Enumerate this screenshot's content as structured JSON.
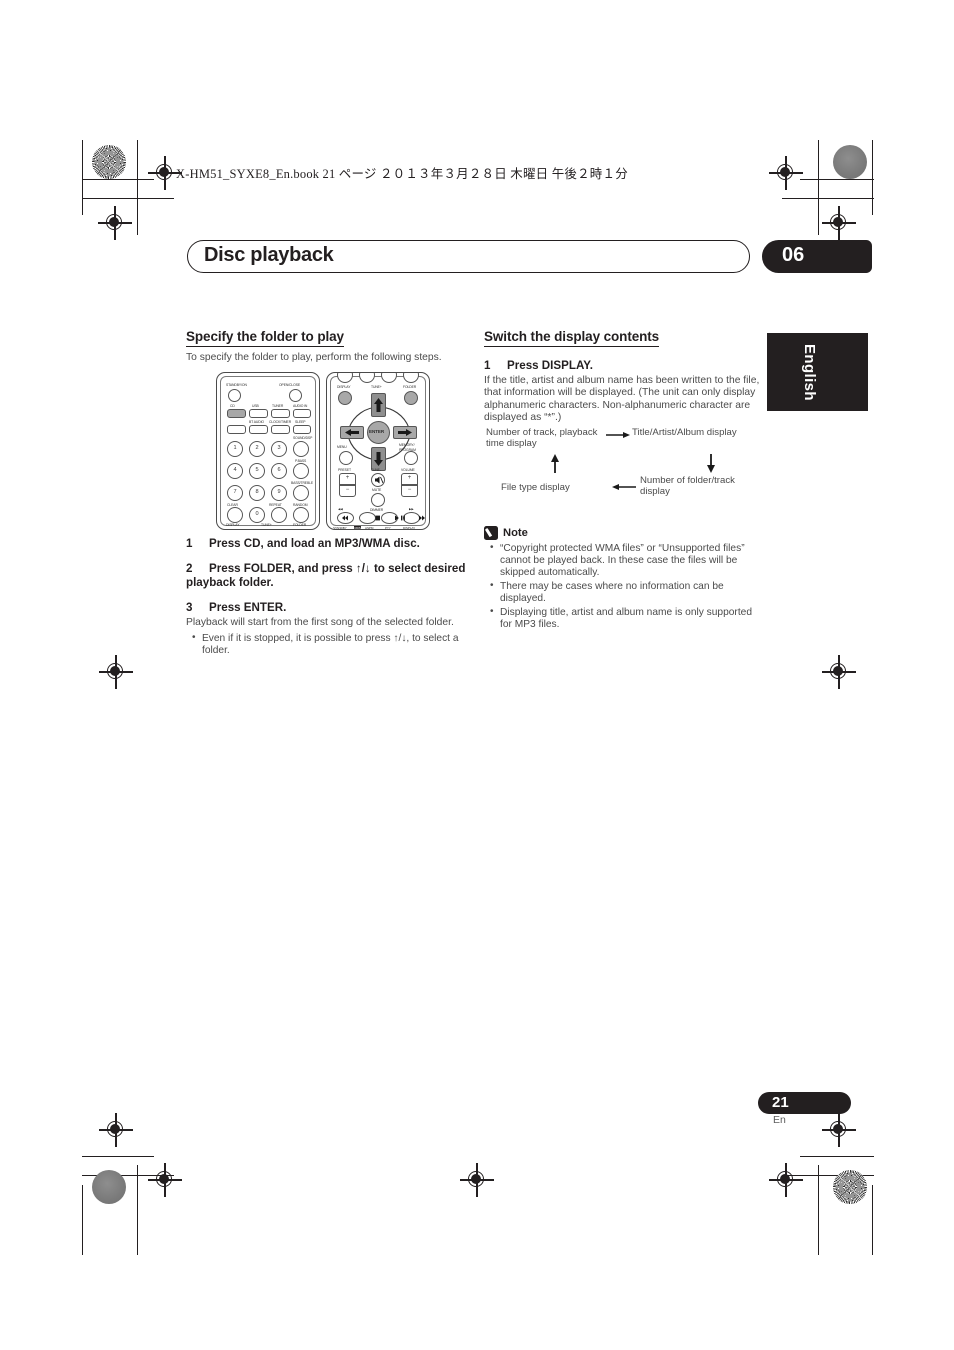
{
  "print_header": {
    "filepath_line": "X-HM51_SYXE8_En.book  21 ページ  ２０１３年３月２８日  木曜日  午後２時１分"
  },
  "chapter": {
    "title": "Disc playback",
    "number": "06"
  },
  "side_tab": {
    "language": "English"
  },
  "footer": {
    "page_number": "21",
    "page_language": "En"
  },
  "left_column": {
    "heading": "Specify the folder to play",
    "intro": "To specify the folder to play, perform the following steps.",
    "steps": [
      {
        "number": "1",
        "text": "Press CD, and load an MP3/WMA disc.",
        "sub": ""
      },
      {
        "number": "2",
        "text": "Press FOLDER, and press ↑/↓ to select desired playback folder.",
        "sub": ""
      },
      {
        "number": "3",
        "text": "Press ENTER.",
        "sub": "Playback will start from the first song of the selected folder."
      }
    ],
    "bullets": [
      "Even if it is stopped, it is possible to press ↑/↓, to select a folder."
    ]
  },
  "right_column": {
    "heading": "Switch the display contents",
    "step": {
      "number": "1",
      "text": "Press DISPLAY.",
      "sub": "If the title, artist and album name has been written to the file, that information will be displayed. (The unit can only display alphanumeric characters. Non-alphanumeric character are displayed as “*”.)"
    },
    "cycle_diagram": {
      "top_left": "Number of track, playback time display",
      "top_right": "Title/Artist/Album display",
      "bottom_left": "File type display",
      "bottom_right": "Number of folder/track display",
      "arrow_right": "→",
      "arrow_left": "←",
      "arrow_up": "↑",
      "arrow_down": "↓"
    },
    "note": {
      "label": "Note",
      "items": [
        "“Copyright protected WMA files” or “Unsupported files” cannot be played back. In these case the files will be skipped automatically.",
        "There may be cases where no information can be displayed.",
        "Displaying title, artist and album name is only supported for MP3 files."
      ]
    }
  },
  "remote_a": {
    "labels": {
      "standby": "STANDBY/ON",
      "open_close": "OPEN/CLOSE",
      "cd": "CD",
      "usb": "USB",
      "tuner": "TUNER",
      "audio_in": "AUDIO IN",
      "bt_audio": "BT AUDIO",
      "clock_timer": "CLOCK/TIMER",
      "sleep": "SLEEP",
      "sound": "SOUND/DSP",
      "pbass": "P.BASS",
      "bass_treble": "BASS/TREBLE",
      "clear": "CLEAR",
      "repeat": "REPEAT",
      "random": "RANDOM",
      "display": "DISPLAY",
      "tune_plus": "TUNE+",
      "folder": "FOLDER"
    },
    "keypad": [
      "1",
      "2",
      "3",
      "4",
      "5",
      "6",
      "7",
      "8",
      "9",
      "0"
    ]
  },
  "remote_b": {
    "labels": {
      "display": "DISPLAY",
      "tune_plus": "TUNE+",
      "folder": "FOLDER",
      "enter": "ENTER",
      "menu": "MENU",
      "memory": "MEMORY/",
      "program": "PROGRAM",
      "preset": "PRESET",
      "tune_minus": "TUNE-",
      "volume": "VOLUME",
      "mute": "MUTE",
      "dimmer": "DIMMER",
      "plus": "+",
      "minus": "−",
      "rew": "◀◀",
      "ffw": "▶▶",
      "standby_b": "STANDBY",
      "rds": "RDS",
      "aspm": "ASPM",
      "pty": "PTY",
      "display_b": "DISPLAY"
    }
  },
  "colors": {
    "ink": "#231f20",
    "body_text": "#4b4b4b",
    "key_fill": "#a8a8a8"
  }
}
